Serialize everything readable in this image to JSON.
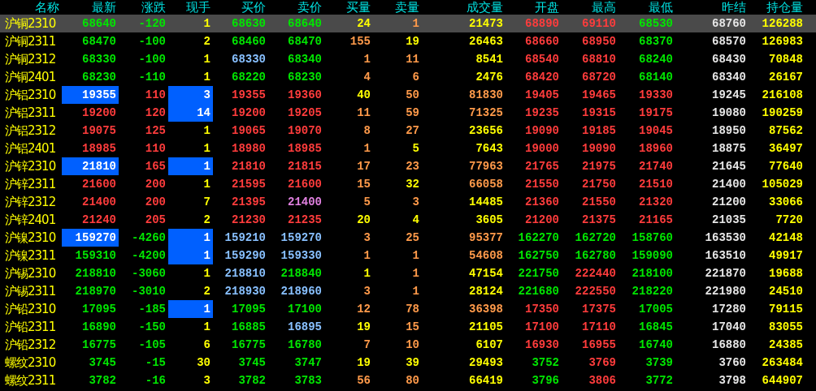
{
  "columns": [
    "名称",
    "最新",
    "涨跌",
    "现手",
    "买价",
    "卖价",
    "买量",
    "卖量",
    "成交量",
    "开盘",
    "最高",
    "最低",
    "昨结",
    "持仓量"
  ],
  "rows": [
    {
      "name": "沪铜2310",
      "selected": true,
      "last_flash": false,
      "vol_flash": false,
      "cells": [
        {
          "text": "68640",
          "color": "#00e600"
        },
        {
          "text": "-120",
          "color": "#00e600"
        },
        {
          "text": "1",
          "color": "#ffff00"
        },
        {
          "text": "68630",
          "color": "#00e600"
        },
        {
          "text": "68640",
          "color": "#00e600"
        },
        {
          "text": "24",
          "color": "#ffff00"
        },
        {
          "text": "1",
          "color": "#ff9a4a"
        },
        {
          "text": "21473",
          "color": "#ffff00"
        },
        {
          "text": "68890",
          "color": "#ff3c3c"
        },
        {
          "text": "69110",
          "color": "#ff3c3c"
        },
        {
          "text": "68530",
          "color": "#00e600"
        },
        {
          "text": "68760",
          "color": "#e6e6e6"
        },
        {
          "text": "126288",
          "color": "#ffff00"
        }
      ]
    },
    {
      "name": "沪铜2311",
      "selected": false,
      "last_flash": false,
      "vol_flash": false,
      "cells": [
        {
          "text": "68470",
          "color": "#00e600"
        },
        {
          "text": "-100",
          "color": "#00e600"
        },
        {
          "text": "2",
          "color": "#ffff00"
        },
        {
          "text": "68460",
          "color": "#00e600"
        },
        {
          "text": "68470",
          "color": "#00e600"
        },
        {
          "text": "155",
          "color": "#ff9a4a"
        },
        {
          "text": "19",
          "color": "#ffff00"
        },
        {
          "text": "26463",
          "color": "#ffff00"
        },
        {
          "text": "68660",
          "color": "#ff3c3c"
        },
        {
          "text": "68950",
          "color": "#ff3c3c"
        },
        {
          "text": "68370",
          "color": "#00e600"
        },
        {
          "text": "68570",
          "color": "#e6e6e6"
        },
        {
          "text": "126983",
          "color": "#ffff00"
        }
      ]
    },
    {
      "name": "沪铜2312",
      "selected": false,
      "last_flash": false,
      "vol_flash": false,
      "cells": [
        {
          "text": "68330",
          "color": "#00e600"
        },
        {
          "text": "-100",
          "color": "#00e600"
        },
        {
          "text": "1",
          "color": "#ffff00"
        },
        {
          "text": "68330",
          "color": "#88c0ff"
        },
        {
          "text": "68340",
          "color": "#00e600"
        },
        {
          "text": "1",
          "color": "#ff9a4a"
        },
        {
          "text": "11",
          "color": "#ff9a4a"
        },
        {
          "text": "8541",
          "color": "#ffff00"
        },
        {
          "text": "68540",
          "color": "#ff3c3c"
        },
        {
          "text": "68810",
          "color": "#ff3c3c"
        },
        {
          "text": "68240",
          "color": "#00e600"
        },
        {
          "text": "68430",
          "color": "#e6e6e6"
        },
        {
          "text": "70848",
          "color": "#ffff00"
        }
      ]
    },
    {
      "name": "沪铜2401",
      "selected": false,
      "last_flash": false,
      "vol_flash": false,
      "cells": [
        {
          "text": "68230",
          "color": "#00e600"
        },
        {
          "text": "-110",
          "color": "#00e600"
        },
        {
          "text": "1",
          "color": "#ffff00"
        },
        {
          "text": "68220",
          "color": "#00e600"
        },
        {
          "text": "68230",
          "color": "#00e600"
        },
        {
          "text": "4",
          "color": "#ff9a4a"
        },
        {
          "text": "6",
          "color": "#ff9a4a"
        },
        {
          "text": "2476",
          "color": "#ffff00"
        },
        {
          "text": "68420",
          "color": "#ff3c3c"
        },
        {
          "text": "68720",
          "color": "#ff3c3c"
        },
        {
          "text": "68140",
          "color": "#00e600"
        },
        {
          "text": "68340",
          "color": "#e6e6e6"
        },
        {
          "text": "26167",
          "color": "#ffff00"
        }
      ]
    },
    {
      "name": "沪铝2310",
      "selected": false,
      "last_flash": true,
      "vol_flash": true,
      "cells": [
        {
          "text": "19355",
          "color": "#ffffff"
        },
        {
          "text": "110",
          "color": "#ff3c3c"
        },
        {
          "text": "3",
          "color": "#ffffff"
        },
        {
          "text": "19355",
          "color": "#ff3c3c"
        },
        {
          "text": "19360",
          "color": "#ff3c3c"
        },
        {
          "text": "40",
          "color": "#ffff00"
        },
        {
          "text": "50",
          "color": "#ff9a4a"
        },
        {
          "text": "81830",
          "color": "#ff9a4a"
        },
        {
          "text": "19405",
          "color": "#ff3c3c"
        },
        {
          "text": "19465",
          "color": "#ff3c3c"
        },
        {
          "text": "19330",
          "color": "#ff3c3c"
        },
        {
          "text": "19245",
          "color": "#e6e6e6"
        },
        {
          "text": "216108",
          "color": "#ffff00"
        }
      ]
    },
    {
      "name": "沪铝2311",
      "selected": false,
      "last_flash": false,
      "vol_flash": true,
      "cells": [
        {
          "text": "19200",
          "color": "#ff3c3c"
        },
        {
          "text": "120",
          "color": "#ff3c3c"
        },
        {
          "text": "14",
          "color": "#ffffff"
        },
        {
          "text": "19200",
          "color": "#ff3c3c"
        },
        {
          "text": "19205",
          "color": "#ff3c3c"
        },
        {
          "text": "11",
          "color": "#ff9a4a"
        },
        {
          "text": "59",
          "color": "#ff9a4a"
        },
        {
          "text": "71325",
          "color": "#ff9a4a"
        },
        {
          "text": "19235",
          "color": "#ff3c3c"
        },
        {
          "text": "19315",
          "color": "#ff3c3c"
        },
        {
          "text": "19175",
          "color": "#ff3c3c"
        },
        {
          "text": "19080",
          "color": "#e6e6e6"
        },
        {
          "text": "190259",
          "color": "#ffff00"
        }
      ]
    },
    {
      "name": "沪铝2312",
      "selected": false,
      "last_flash": false,
      "vol_flash": false,
      "cells": [
        {
          "text": "19075",
          "color": "#ff3c3c"
        },
        {
          "text": "125",
          "color": "#ff3c3c"
        },
        {
          "text": "1",
          "color": "#ffff00"
        },
        {
          "text": "19065",
          "color": "#ff3c3c"
        },
        {
          "text": "19070",
          "color": "#ff3c3c"
        },
        {
          "text": "8",
          "color": "#ff9a4a"
        },
        {
          "text": "27",
          "color": "#ff9a4a"
        },
        {
          "text": "23656",
          "color": "#ffff00"
        },
        {
          "text": "19090",
          "color": "#ff3c3c"
        },
        {
          "text": "19185",
          "color": "#ff3c3c"
        },
        {
          "text": "19045",
          "color": "#ff3c3c"
        },
        {
          "text": "18950",
          "color": "#e6e6e6"
        },
        {
          "text": "87562",
          "color": "#ffff00"
        }
      ]
    },
    {
      "name": "沪铝2401",
      "selected": false,
      "last_flash": false,
      "vol_flash": false,
      "cells": [
        {
          "text": "18985",
          "color": "#ff3c3c"
        },
        {
          "text": "110",
          "color": "#ff3c3c"
        },
        {
          "text": "1",
          "color": "#ffff00"
        },
        {
          "text": "18980",
          "color": "#ff3c3c"
        },
        {
          "text": "18985",
          "color": "#ff3c3c"
        },
        {
          "text": "1",
          "color": "#ff9a4a"
        },
        {
          "text": "5",
          "color": "#ffff00"
        },
        {
          "text": "7643",
          "color": "#ffff00"
        },
        {
          "text": "19000",
          "color": "#ff3c3c"
        },
        {
          "text": "19090",
          "color": "#ff3c3c"
        },
        {
          "text": "18960",
          "color": "#ff3c3c"
        },
        {
          "text": "18875",
          "color": "#e6e6e6"
        },
        {
          "text": "36497",
          "color": "#ffff00"
        }
      ]
    },
    {
      "name": "沪锌2310",
      "selected": false,
      "last_flash": true,
      "vol_flash": true,
      "cells": [
        {
          "text": "21810",
          "color": "#ffffff"
        },
        {
          "text": "165",
          "color": "#ff3c3c"
        },
        {
          "text": "1",
          "color": "#ffffff"
        },
        {
          "text": "21810",
          "color": "#ff3c3c"
        },
        {
          "text": "21815",
          "color": "#ff3c3c"
        },
        {
          "text": "17",
          "color": "#ff9a4a"
        },
        {
          "text": "23",
          "color": "#ff9a4a"
        },
        {
          "text": "77963",
          "color": "#ff9a4a"
        },
        {
          "text": "21765",
          "color": "#ff3c3c"
        },
        {
          "text": "21975",
          "color": "#ff3c3c"
        },
        {
          "text": "21740",
          "color": "#ff3c3c"
        },
        {
          "text": "21645",
          "color": "#e6e6e6"
        },
        {
          "text": "77640",
          "color": "#ffff00"
        }
      ]
    },
    {
      "name": "沪锌2311",
      "selected": false,
      "last_flash": false,
      "vol_flash": false,
      "cells": [
        {
          "text": "21600",
          "color": "#ff3c3c"
        },
        {
          "text": "200",
          "color": "#ff3c3c"
        },
        {
          "text": "1",
          "color": "#ffff00"
        },
        {
          "text": "21595",
          "color": "#ff3c3c"
        },
        {
          "text": "21600",
          "color": "#ff3c3c"
        },
        {
          "text": "15",
          "color": "#ff9a4a"
        },
        {
          "text": "32",
          "color": "#ffff00"
        },
        {
          "text": "66058",
          "color": "#ff9a4a"
        },
        {
          "text": "21550",
          "color": "#ff3c3c"
        },
        {
          "text": "21750",
          "color": "#ff3c3c"
        },
        {
          "text": "21510",
          "color": "#ff3c3c"
        },
        {
          "text": "21400",
          "color": "#e6e6e6"
        },
        {
          "text": "105029",
          "color": "#ffff00"
        }
      ]
    },
    {
      "name": "沪锌2312",
      "selected": false,
      "last_flash": false,
      "vol_flash": false,
      "cells": [
        {
          "text": "21400",
          "color": "#ff3c3c"
        },
        {
          "text": "200",
          "color": "#ff3c3c"
        },
        {
          "text": "7",
          "color": "#ffff00"
        },
        {
          "text": "21395",
          "color": "#ff3c3c"
        },
        {
          "text": "21400",
          "color": "#e080e0"
        },
        {
          "text": "5",
          "color": "#ff9a4a"
        },
        {
          "text": "3",
          "color": "#ff9a4a"
        },
        {
          "text": "14485",
          "color": "#ffff00"
        },
        {
          "text": "21360",
          "color": "#ff3c3c"
        },
        {
          "text": "21550",
          "color": "#ff3c3c"
        },
        {
          "text": "21320",
          "color": "#ff3c3c"
        },
        {
          "text": "21200",
          "color": "#e6e6e6"
        },
        {
          "text": "33066",
          "color": "#ffff00"
        }
      ]
    },
    {
      "name": "沪锌2401",
      "selected": false,
      "last_flash": false,
      "vol_flash": false,
      "cells": [
        {
          "text": "21240",
          "color": "#ff3c3c"
        },
        {
          "text": "205",
          "color": "#ff3c3c"
        },
        {
          "text": "2",
          "color": "#ffff00"
        },
        {
          "text": "21230",
          "color": "#ff3c3c"
        },
        {
          "text": "21235",
          "color": "#ff3c3c"
        },
        {
          "text": "20",
          "color": "#ffff00"
        },
        {
          "text": "4",
          "color": "#ffff00"
        },
        {
          "text": "3605",
          "color": "#ffff00"
        },
        {
          "text": "21200",
          "color": "#ff3c3c"
        },
        {
          "text": "21375",
          "color": "#ff3c3c"
        },
        {
          "text": "21165",
          "color": "#ff3c3c"
        },
        {
          "text": "21035",
          "color": "#e6e6e6"
        },
        {
          "text": "7720",
          "color": "#ffff00"
        }
      ]
    },
    {
      "name": "沪镍2310",
      "selected": false,
      "last_flash": true,
      "vol_flash": true,
      "cells": [
        {
          "text": "159270",
          "color": "#ffffff"
        },
        {
          "text": "-4260",
          "color": "#00e600"
        },
        {
          "text": "1",
          "color": "#ffffff"
        },
        {
          "text": "159210",
          "color": "#88c0ff"
        },
        {
          "text": "159270",
          "color": "#88c0ff"
        },
        {
          "text": "3",
          "color": "#ff9a4a"
        },
        {
          "text": "25",
          "color": "#ff9a4a"
        },
        {
          "text": "95377",
          "color": "#ff9a4a"
        },
        {
          "text": "162270",
          "color": "#00e600"
        },
        {
          "text": "162720",
          "color": "#00e600"
        },
        {
          "text": "158760",
          "color": "#00e600"
        },
        {
          "text": "163530",
          "color": "#e6e6e6"
        },
        {
          "text": "42148",
          "color": "#ffff00"
        }
      ]
    },
    {
      "name": "沪镍2311",
      "selected": false,
      "last_flash": false,
      "vol_flash": true,
      "cells": [
        {
          "text": "159310",
          "color": "#00e600"
        },
        {
          "text": "-4200",
          "color": "#00e600"
        },
        {
          "text": "1",
          "color": "#ffffff"
        },
        {
          "text": "159290",
          "color": "#88c0ff"
        },
        {
          "text": "159330",
          "color": "#88c0ff"
        },
        {
          "text": "1",
          "color": "#ff9a4a"
        },
        {
          "text": "1",
          "color": "#ff9a4a"
        },
        {
          "text": "54608",
          "color": "#ff9a4a"
        },
        {
          "text": "162750",
          "color": "#00e600"
        },
        {
          "text": "162780",
          "color": "#00e600"
        },
        {
          "text": "159090",
          "color": "#00e600"
        },
        {
          "text": "163510",
          "color": "#e6e6e6"
        },
        {
          "text": "49917",
          "color": "#ffff00"
        }
      ]
    },
    {
      "name": "沪锡2310",
      "selected": false,
      "last_flash": false,
      "vol_flash": false,
      "cells": [
        {
          "text": "218810",
          "color": "#00e600"
        },
        {
          "text": "-3060",
          "color": "#00e600"
        },
        {
          "text": "1",
          "color": "#ffff00"
        },
        {
          "text": "218810",
          "color": "#88c0ff"
        },
        {
          "text": "218840",
          "color": "#00e600"
        },
        {
          "text": "1",
          "color": "#ffff00"
        },
        {
          "text": "1",
          "color": "#ff9a4a"
        },
        {
          "text": "47154",
          "color": "#ffff00"
        },
        {
          "text": "221750",
          "color": "#00e600"
        },
        {
          "text": "222440",
          "color": "#ff3c3c"
        },
        {
          "text": "218100",
          "color": "#00e600"
        },
        {
          "text": "221870",
          "color": "#e6e6e6"
        },
        {
          "text": "19688",
          "color": "#ffff00"
        }
      ]
    },
    {
      "name": "沪锡2311",
      "selected": false,
      "last_flash": false,
      "vol_flash": false,
      "cells": [
        {
          "text": "218970",
          "color": "#00e600"
        },
        {
          "text": "-3010",
          "color": "#00e600"
        },
        {
          "text": "2",
          "color": "#ffff00"
        },
        {
          "text": "218930",
          "color": "#88c0ff"
        },
        {
          "text": "218960",
          "color": "#88c0ff"
        },
        {
          "text": "3",
          "color": "#ff9a4a"
        },
        {
          "text": "1",
          "color": "#ff9a4a"
        },
        {
          "text": "28124",
          "color": "#ffff00"
        },
        {
          "text": "221680",
          "color": "#00e600"
        },
        {
          "text": "222550",
          "color": "#ff3c3c"
        },
        {
          "text": "218220",
          "color": "#00e600"
        },
        {
          "text": "221980",
          "color": "#e6e6e6"
        },
        {
          "text": "24510",
          "color": "#ffff00"
        }
      ]
    },
    {
      "name": "沪铅2310",
      "selected": false,
      "last_flash": false,
      "vol_flash": true,
      "cells": [
        {
          "text": "17095",
          "color": "#00e600"
        },
        {
          "text": "-185",
          "color": "#00e600"
        },
        {
          "text": "1",
          "color": "#ffffff"
        },
        {
          "text": "17095",
          "color": "#00e600"
        },
        {
          "text": "17100",
          "color": "#00e600"
        },
        {
          "text": "12",
          "color": "#ff9a4a"
        },
        {
          "text": "78",
          "color": "#ff9a4a"
        },
        {
          "text": "36398",
          "color": "#ff9a4a"
        },
        {
          "text": "17350",
          "color": "#ff3c3c"
        },
        {
          "text": "17375",
          "color": "#ff3c3c"
        },
        {
          "text": "17005",
          "color": "#00e600"
        },
        {
          "text": "17280",
          "color": "#e6e6e6"
        },
        {
          "text": "79115",
          "color": "#ffff00"
        }
      ]
    },
    {
      "name": "沪铅2311",
      "selected": false,
      "last_flash": false,
      "vol_flash": false,
      "cells": [
        {
          "text": "16890",
          "color": "#00e600"
        },
        {
          "text": "-150",
          "color": "#00e600"
        },
        {
          "text": "1",
          "color": "#ffff00"
        },
        {
          "text": "16885",
          "color": "#00e600"
        },
        {
          "text": "16895",
          "color": "#88c0ff"
        },
        {
          "text": "19",
          "color": "#ffff00"
        },
        {
          "text": "15",
          "color": "#ff9a4a"
        },
        {
          "text": "21105",
          "color": "#ffff00"
        },
        {
          "text": "17100",
          "color": "#ff3c3c"
        },
        {
          "text": "17110",
          "color": "#ff3c3c"
        },
        {
          "text": "16845",
          "color": "#00e600"
        },
        {
          "text": "17040",
          "color": "#e6e6e6"
        },
        {
          "text": "83055",
          "color": "#ffff00"
        }
      ]
    },
    {
      "name": "沪铅2312",
      "selected": false,
      "last_flash": false,
      "vol_flash": false,
      "cells": [
        {
          "text": "16775",
          "color": "#00e600"
        },
        {
          "text": "-105",
          "color": "#00e600"
        },
        {
          "text": "6",
          "color": "#ffff00"
        },
        {
          "text": "16775",
          "color": "#00e600"
        },
        {
          "text": "16780",
          "color": "#00e600"
        },
        {
          "text": "7",
          "color": "#ff9a4a"
        },
        {
          "text": "10",
          "color": "#ff9a4a"
        },
        {
          "text": "6107",
          "color": "#ffff00"
        },
        {
          "text": "16930",
          "color": "#ff3c3c"
        },
        {
          "text": "16955",
          "color": "#ff3c3c"
        },
        {
          "text": "16740",
          "color": "#00e600"
        },
        {
          "text": "16880",
          "color": "#e6e6e6"
        },
        {
          "text": "24385",
          "color": "#ffff00"
        }
      ]
    },
    {
      "name": "螺纹2310",
      "selected": false,
      "last_flash": false,
      "vol_flash": false,
      "cells": [
        {
          "text": "3745",
          "color": "#00e600"
        },
        {
          "text": "-15",
          "color": "#00e600"
        },
        {
          "text": "30",
          "color": "#ffff00"
        },
        {
          "text": "3745",
          "color": "#00e600"
        },
        {
          "text": "3747",
          "color": "#00e600"
        },
        {
          "text": "19",
          "color": "#ffff00"
        },
        {
          "text": "39",
          "color": "#ffff00"
        },
        {
          "text": "29493",
          "color": "#ffff00"
        },
        {
          "text": "3752",
          "color": "#00e600"
        },
        {
          "text": "3769",
          "color": "#ff3c3c"
        },
        {
          "text": "3739",
          "color": "#00e600"
        },
        {
          "text": "3760",
          "color": "#e6e6e6"
        },
        {
          "text": "263484",
          "color": "#ffff00"
        }
      ]
    },
    {
      "name": "螺纹2311",
      "selected": false,
      "last_flash": false,
      "vol_flash": false,
      "cells": [
        {
          "text": "3782",
          "color": "#00e600"
        },
        {
          "text": "-16",
          "color": "#00e600"
        },
        {
          "text": "3",
          "color": "#ffff00"
        },
        {
          "text": "3782",
          "color": "#00e600"
        },
        {
          "text": "3783",
          "color": "#00e600"
        },
        {
          "text": "56",
          "color": "#ff9a4a"
        },
        {
          "text": "80",
          "color": "#ff9a4a"
        },
        {
          "text": "66419",
          "color": "#ffff00"
        },
        {
          "text": "3796",
          "color": "#00e600"
        },
        {
          "text": "3806",
          "color": "#ff3c3c"
        },
        {
          "text": "3772",
          "color": "#00e600"
        },
        {
          "text": "3798",
          "color": "#e6e6e6"
        },
        {
          "text": "644907",
          "color": "#ffff00"
        }
      ]
    }
  ]
}
